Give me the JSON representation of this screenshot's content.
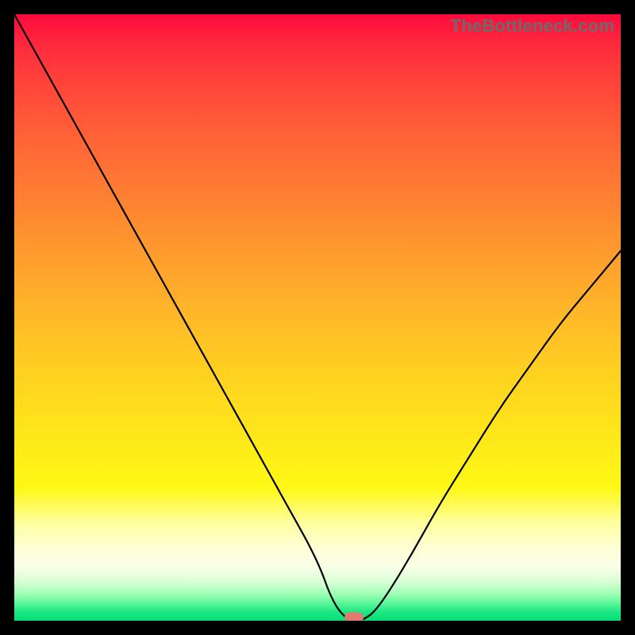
{
  "watermark": "TheBottleneck.com",
  "chart_data": {
    "type": "line",
    "title": "",
    "xlabel": "",
    "ylabel": "",
    "x": [
      0.0,
      0.05,
      0.1,
      0.15,
      0.2,
      0.25,
      0.3,
      0.35,
      0.4,
      0.45,
      0.5,
      0.525,
      0.55,
      0.575,
      0.6,
      0.65,
      0.7,
      0.75,
      0.8,
      0.85,
      0.9,
      0.95,
      1.0
    ],
    "values": [
      100,
      91,
      82,
      73,
      64,
      55,
      46,
      37,
      28,
      19,
      10,
      3,
      0,
      0,
      2,
      10,
      19,
      27,
      35,
      42,
      49,
      55,
      61
    ],
    "xlim": [
      0,
      1
    ],
    "ylim": [
      0,
      100
    ],
    "marker": {
      "x": 0.56,
      "y": 0.5
    },
    "colors": {
      "curve": "#000000",
      "marker": "#e27a6f",
      "gradient_top": "#ff0a3c",
      "gradient_bottom": "#03df76"
    }
  }
}
